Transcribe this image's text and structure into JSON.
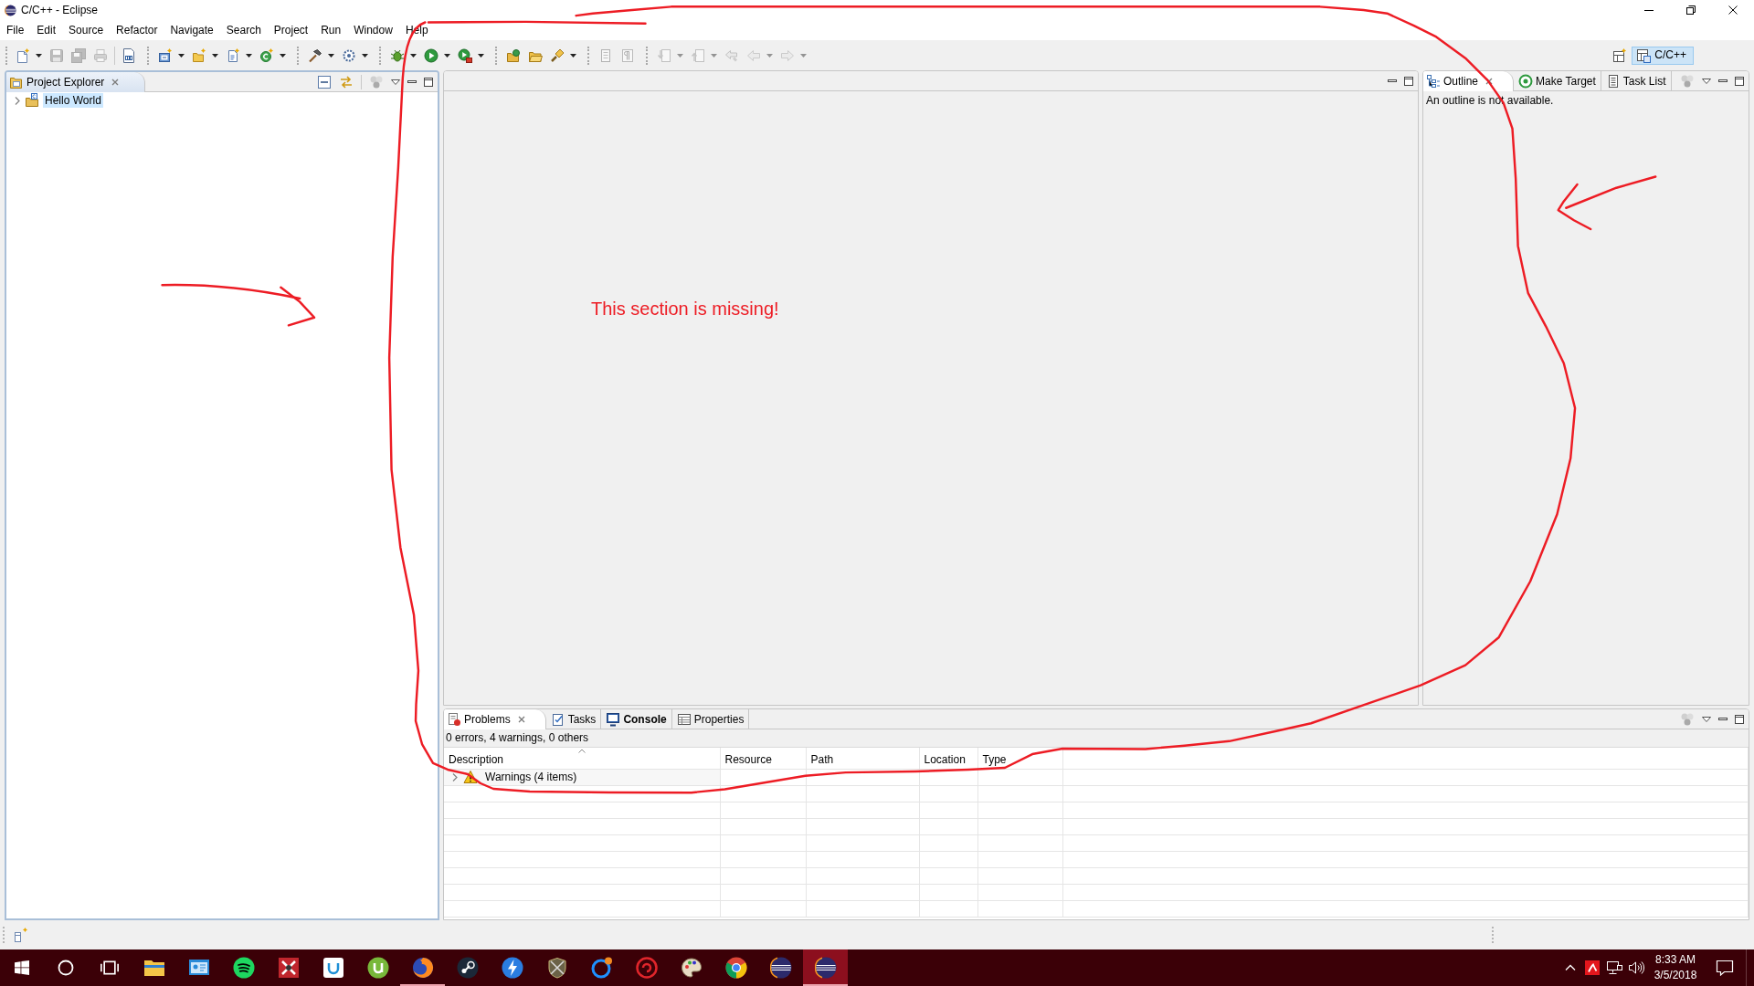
{
  "window": {
    "title": "C/C++ - Eclipse"
  },
  "menu": [
    "File",
    "Edit",
    "Source",
    "Refactor",
    "Navigate",
    "Search",
    "Project",
    "Run",
    "Window",
    "Help"
  ],
  "toolbar": {
    "groups": [
      {
        "grip": true,
        "items": [
          {
            "dropdown": true,
            "disabled": false
          },
          {
            "dropdown": false,
            "disabled": true
          },
          {
            "dropdown": false,
            "disabled": true
          },
          {
            "dropdown": false,
            "disabled": true
          }
        ]
      },
      {
        "grip": false,
        "items": [
          {
            "dropdown": false,
            "disabled": false
          }
        ]
      },
      {
        "grip": true,
        "items": [
          {
            "dropdown": true,
            "disabled": false
          },
          {
            "dropdown": true,
            "disabled": false
          },
          {
            "dropdown": true,
            "disabled": false
          },
          {
            "dropdown": true,
            "disabled": false
          }
        ]
      },
      {
        "grip": true,
        "items": [
          {
            "dropdown": true,
            "disabled": false
          },
          {
            "dropdown": true,
            "disabled": false
          }
        ]
      },
      {
        "grip": true,
        "items": [
          {
            "dropdown": true,
            "disabled": false
          },
          {
            "dropdown": true,
            "disabled": false
          },
          {
            "dropdown": true,
            "disabled": false
          }
        ]
      },
      {
        "grip": true,
        "items": [
          {
            "dropdown": false,
            "disabled": false
          },
          {
            "dropdown": false,
            "disabled": false
          },
          {
            "dropdown": true,
            "disabled": false
          }
        ]
      },
      {
        "grip": true,
        "items": [
          {
            "dropdown": false,
            "disabled": true
          },
          {
            "dropdown": false,
            "disabled": true
          }
        ]
      },
      {
        "grip": true,
        "items": [
          {
            "dropdown": true,
            "disabled": true
          },
          {
            "dropdown": true,
            "disabled": true
          },
          {
            "dropdown": false,
            "disabled": true
          },
          {
            "dropdown": true,
            "disabled": true
          },
          {
            "dropdown": true,
            "disabled": true
          }
        ]
      }
    ]
  },
  "perspective": {
    "label": "C/C++",
    "selected": true
  },
  "project_explorer": {
    "focused": true,
    "tabs": [
      {
        "label": "Project Explorer",
        "selected": true
      }
    ],
    "tree": [
      {
        "label": "Hello World",
        "expanded": false,
        "selected": true
      }
    ]
  },
  "outline": {
    "focused": false,
    "tabs": [
      {
        "label": "Outline",
        "selected": true
      },
      {
        "label": "Make Target",
        "selected": false
      },
      {
        "label": "Task List",
        "selected": false
      }
    ],
    "message": "An outline is not available."
  },
  "bottom_panel": {
    "focused": false,
    "tabs": [
      {
        "label": "Problems",
        "selected": true,
        "emphasized": false
      },
      {
        "label": "Tasks",
        "selected": false,
        "emphasized": false
      },
      {
        "label": "Console",
        "selected": false,
        "emphasized": true
      },
      {
        "label": "Properties",
        "selected": false,
        "emphasized": false
      }
    ],
    "summary": "0 errors, 4 warnings, 0 others",
    "columns": [
      {
        "label": "Description",
        "sorted": true
      },
      {
        "label": "Resource",
        "sorted": false
      },
      {
        "label": "Path",
        "sorted": false
      },
      {
        "label": "Location",
        "sorted": false
      },
      {
        "label": "Type",
        "sorted": false
      }
    ],
    "rows": [
      {
        "label": "Warnings (4 items)",
        "expanded": false
      }
    ]
  },
  "annotation": {
    "text": "This section is missing!"
  },
  "taskbar": {
    "apps": [
      {
        "running": false,
        "active": false
      },
      {
        "running": false,
        "active": false
      },
      {
        "running": false,
        "active": false
      },
      {
        "running": false,
        "active": false
      },
      {
        "running": false,
        "active": false
      },
      {
        "running": false,
        "active": false
      },
      {
        "running": true,
        "active": false
      },
      {
        "running": false,
        "active": false
      },
      {
        "running": false,
        "active": false
      },
      {
        "running": false,
        "active": false
      },
      {
        "running": false,
        "active": false
      },
      {
        "running": false,
        "active": false
      },
      {
        "running": false,
        "active": false
      },
      {
        "running": false,
        "active": false
      },
      {
        "running": false,
        "active": false
      },
      {
        "running": true,
        "active": true
      }
    ],
    "time": "8:33 AM",
    "date": "3/5/2018"
  }
}
